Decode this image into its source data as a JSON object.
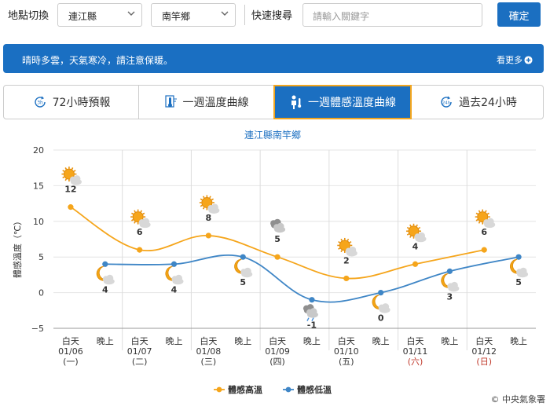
{
  "top_bar": {
    "location_switch_label": "地點切換",
    "county_value": "連江縣",
    "township_value": "南竿鄉",
    "quick_search_label": "快速搜尋",
    "search_placeholder": "請輸入關鍵字",
    "confirm_label": "確定"
  },
  "banner": {
    "message": "晴時多雲，天氣寒冷，請注意保暖。",
    "more_label": "看更多"
  },
  "tabs": [
    {
      "label": "72小時預報",
      "icon": "72h-clock-icon",
      "active": false
    },
    {
      "label": "一週溫度曲線",
      "icon": "thermometer-icon",
      "active": false
    },
    {
      "label": "一週體感溫度曲線",
      "icon": "person-temperature-icon",
      "active": true
    },
    {
      "label": "過去24小時",
      "icon": "24h-clock-icon",
      "active": false
    }
  ],
  "copyright": "© 中央氣象署",
  "colors": {
    "high": "#f5a51b",
    "low": "#3f86c6",
    "accent": "#1b6fc1",
    "active_border": "#f2a620"
  },
  "chart_data": {
    "type": "line",
    "title": "連江縣南竿鄉",
    "ylabel": "體感溫度（℃）",
    "ylim": [
      -5,
      20
    ],
    "yticks": [
      -5,
      0,
      5,
      10,
      15,
      20
    ],
    "grid": true,
    "legend_position": "bottom",
    "categories": [
      {
        "period": "白天",
        "date": "01/06",
        "weekday": "(一)",
        "weekend": false
      },
      {
        "period": "晚上",
        "date": "",
        "weekday": "",
        "weekend": false
      },
      {
        "period": "白天",
        "date": "01/07",
        "weekday": "(二)",
        "weekend": false
      },
      {
        "period": "晚上",
        "date": "",
        "weekday": "",
        "weekend": false
      },
      {
        "period": "白天",
        "date": "01/08",
        "weekday": "(三)",
        "weekend": false
      },
      {
        "period": "晚上",
        "date": "",
        "weekday": "",
        "weekend": false
      },
      {
        "period": "白天",
        "date": "01/09",
        "weekday": "(四)",
        "weekend": false
      },
      {
        "period": "晚上",
        "date": "",
        "weekday": "",
        "weekend": false
      },
      {
        "period": "白天",
        "date": "01/10",
        "weekday": "(五)",
        "weekend": false
      },
      {
        "period": "晚上",
        "date": "",
        "weekday": "",
        "weekend": false
      },
      {
        "period": "白天",
        "date": "01/11",
        "weekday": "(六)",
        "weekend": true
      },
      {
        "period": "晚上",
        "date": "",
        "weekday": "",
        "weekend": false
      },
      {
        "period": "白天",
        "date": "01/12",
        "weekday": "(日)",
        "weekend": true
      },
      {
        "period": "晚上",
        "date": "",
        "weekday": "",
        "weekend": false
      }
    ],
    "series": [
      {
        "name": "體感高溫",
        "color": "#f5a51b",
        "category_index": [
          0,
          2,
          4,
          6,
          8,
          10,
          12
        ],
        "values": [
          12,
          6,
          8,
          5,
          2,
          4,
          6
        ]
      },
      {
        "name": "體感低溫",
        "color": "#3f86c6",
        "category_index": [
          1,
          3,
          5,
          7,
          9,
          11,
          13
        ],
        "values": [
          4,
          4,
          5,
          -1,
          0,
          3,
          5
        ]
      }
    ],
    "weather_icons": [
      {
        "category_index": 0,
        "icon": "sunny-cloud-icon"
      },
      {
        "category_index": 1,
        "icon": "moon-cloud-icon"
      },
      {
        "category_index": 2,
        "icon": "sunny-cloud-icon"
      },
      {
        "category_index": 3,
        "icon": "moon-cloud-icon"
      },
      {
        "category_index": 4,
        "icon": "sunny-cloud-icon"
      },
      {
        "category_index": 5,
        "icon": "moon-cloud-icon"
      },
      {
        "category_index": 6,
        "icon": "cloudy-icon"
      },
      {
        "category_index": 7,
        "icon": "cloudy-rain-icon"
      },
      {
        "category_index": 8,
        "icon": "sunny-cloud-icon"
      },
      {
        "category_index": 9,
        "icon": "moon-cloud-icon"
      },
      {
        "category_index": 10,
        "icon": "sunny-cloud-icon"
      },
      {
        "category_index": 11,
        "icon": "moon-cloud-icon"
      },
      {
        "category_index": 12,
        "icon": "sunny-cloud-icon"
      },
      {
        "category_index": 13,
        "icon": "moon-cloud-icon"
      }
    ]
  }
}
